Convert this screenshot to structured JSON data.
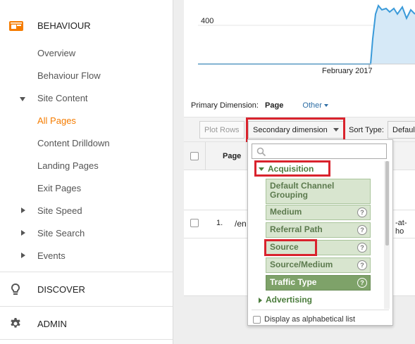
{
  "sidebar": {
    "behaviour_label": "BEHAVIOUR",
    "items": {
      "overview": "Overview",
      "behaviour_flow": "Behaviour Flow",
      "site_content": "Site Content",
      "all_pages": "All Pages",
      "content_drilldown": "Content Drilldown",
      "landing_pages": "Landing Pages",
      "exit_pages": "Exit Pages",
      "site_speed": "Site Speed",
      "site_search": "Site Search",
      "events": "Events"
    },
    "discover_label": "DISCOVER",
    "admin_label": "ADMIN"
  },
  "chart": {
    "y_tick": "400",
    "x_tick": "February 2017"
  },
  "primary_dimension": {
    "label": "Primary Dimension:",
    "value": "Page",
    "other": "Other"
  },
  "toolbar": {
    "plot_rows": "Plot Rows",
    "secondary_dimension": "Secondary dimension",
    "sort_type_label": "Sort Type:",
    "sort_type_value": "Defaul"
  },
  "table": {
    "page_header": "Page",
    "row_index": "1.",
    "row_url_fragment": "/en",
    "row_tail_fragment": "-at-ho"
  },
  "dropdown": {
    "search_placeholder": "",
    "acquisition_label": "Acquisition",
    "options": {
      "default_channel_grouping": "Default Channel Grouping",
      "medium": "Medium",
      "referral_path": "Referral Path",
      "source": "Source",
      "source_medium": "Source/Medium",
      "traffic_type": "Traffic Type"
    },
    "advertising_label": "Advertising",
    "alphabetical": "Display as alphabetical list"
  },
  "colors": {
    "accent_orange": "#f57c00",
    "highlight_red": "#d9232d",
    "chart_line": "#3a9ad9",
    "option_green": "#d8e5cf",
    "option_selected": "#7ea269"
  }
}
